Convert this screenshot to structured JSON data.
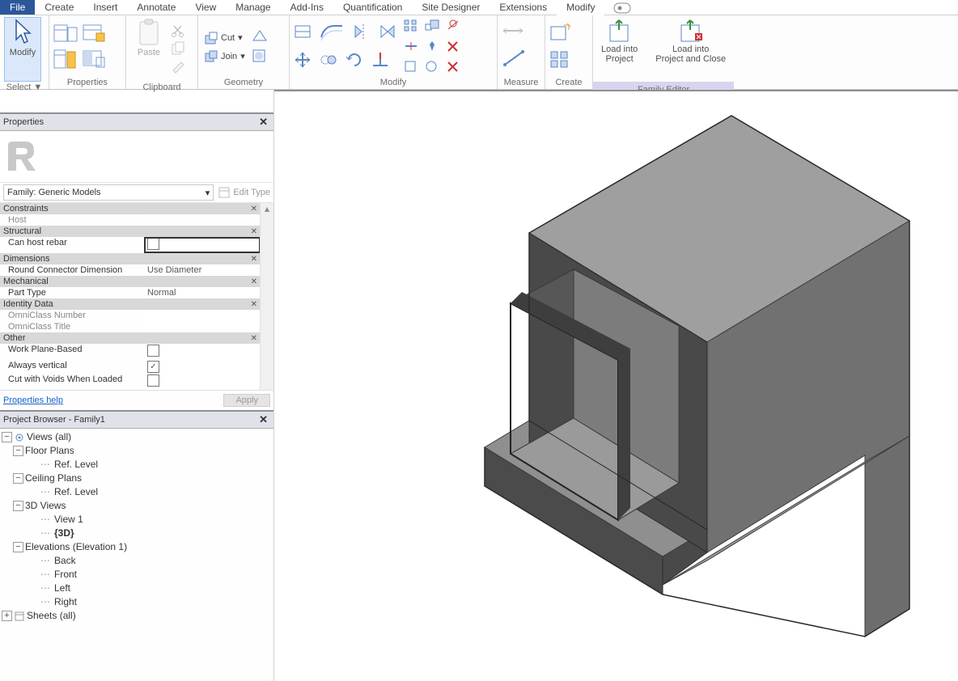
{
  "tabs": {
    "file": "File",
    "items": [
      "Create",
      "Insert",
      "Annotate",
      "View",
      "Manage",
      "Add-Ins",
      "Quantification",
      "Site Designer",
      "Extensions"
    ],
    "active": "Modify"
  },
  "ribbon": {
    "select": {
      "modify": "Modify",
      "label": "Select ▼"
    },
    "properties_label": "Properties",
    "clipboard": {
      "paste": "Paste",
      "label": "Clipboard"
    },
    "geometry": {
      "cut": "Cut",
      "join": "Join",
      "label": "Geometry"
    },
    "modify_label": "Modify",
    "measure_label": "Measure",
    "create_label": "Create",
    "load_project": "Load into\nProject",
    "load_project_close": "Load into\nProject and Close",
    "family_editor": "Family Editor"
  },
  "properties": {
    "title": "Properties",
    "family_label": "Family: Generic Models",
    "edit_type": "Edit Type",
    "groups": {
      "constraints": "Constraints",
      "structural": "Structural",
      "dimensions": "Dimensions",
      "mechanical": "Mechanical",
      "identity": "Identity Data",
      "other": "Other"
    },
    "rows": {
      "host": "Host",
      "can_host_rebar": "Can host rebar",
      "round_connector": "Round Connector Dimension",
      "round_connector_val": "Use Diameter",
      "part_type": "Part Type",
      "part_type_val": "Normal",
      "omni_num": "OmniClass Number",
      "omni_title": "OmniClass Title",
      "work_plane": "Work Plane-Based",
      "always_vert": "Always vertical",
      "cut_voids": "Cut with Voids When Loaded"
    },
    "help": "Properties help",
    "apply": "Apply"
  },
  "browser": {
    "title": "Project Browser - Family1",
    "views_all": "Views (all)",
    "floor_plans": "Floor Plans",
    "ref_level": "Ref. Level",
    "ceiling_plans": "Ceiling Plans",
    "three_d": "3D Views",
    "view1": "View 1",
    "three_d_cur": "{3D}",
    "elevations": "Elevations (Elevation 1)",
    "back": "Back",
    "front": "Front",
    "left": "Left",
    "right": "Right",
    "sheets": "Sheets (all)"
  }
}
